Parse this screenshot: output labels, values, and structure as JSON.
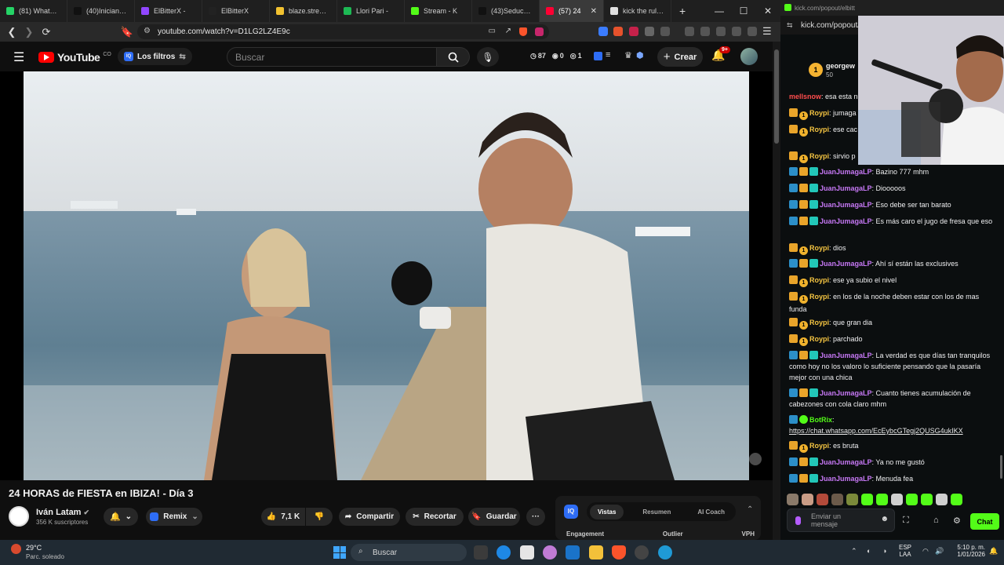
{
  "browser": {
    "tabs": [
      {
        "label": "(81) WhatsApp",
        "color": "#25d366"
      },
      {
        "label": "(40)Iniciando r",
        "color": "#111111"
      },
      {
        "label": "ElBitterX -",
        "color": "#9146ff"
      },
      {
        "label": "ElBitterX",
        "color": "#222222"
      },
      {
        "label": "blaze.stream/s",
        "color": "#f2c230"
      },
      {
        "label": "Llori Pari -",
        "color": "#1db954"
      },
      {
        "label": "Stream - K",
        "color": "#53fc18"
      },
      {
        "label": "(43)SeduceLa",
        "color": "#111111"
      },
      {
        "label": "(57) 24",
        "color": "#ff0033",
        "active": true
      },
      {
        "label": "kick the rules t",
        "color": "#e0e0e0"
      }
    ],
    "new_tab": "+",
    "url": "youtube.com/watch?v=D1LG2LZ4E9c",
    "minimize": "—",
    "maximize": "☐",
    "close": "✕"
  },
  "youtube": {
    "logo": "YouTube",
    "logo_country": "CO",
    "filters_label": "Los filtros",
    "search_placeholder": "Buscar",
    "stats": {
      "views": "87",
      "eye": "0",
      "other": "1"
    },
    "create_label": "Crear",
    "notif_count": "9+",
    "video": {
      "title": "24 HORAS de FIESTA en IBIZA! - Día 3",
      "channel": "Iván Latam",
      "subscribers": "356 K suscriptores",
      "remix_label": "Remix",
      "likes": "7,1 K",
      "share_label": "Compartir",
      "clip_label": "Recortar",
      "save_label": "Guardar",
      "more_label": "···"
    },
    "vidiq": {
      "tabs": [
        "Vistas",
        "Resumen",
        "AI Coach"
      ],
      "active_tab": "Vistas",
      "metrics": [
        "Engagement",
        "Outlier",
        "VPH"
      ]
    }
  },
  "kick": {
    "popout_url": "kick.com/popout/elbitt",
    "popout_url_2": "kick.com/popout/",
    "top_gifter": {
      "name": "georgew",
      "amount": "50"
    },
    "pinned_fragment": {
      "user": "mellsnow",
      "text": ": esa esta n"
    },
    "messages": [
      {
        "user": "Roypi",
        "color": "#f5c542",
        "badges": [
          "crown",
          "sub"
        ],
        "text": ": jumaga"
      },
      {
        "user": "Roypi",
        "color": "#f5c542",
        "badges": [
          "crown",
          "sub"
        ],
        "text": ": ese cac grupo"
      },
      {
        "user": "Roypi",
        "color": "#f5c542",
        "badges": [
          "crown",
          "sub"
        ],
        "text": ": sirvio p"
      },
      {
        "user": "JuanJumagaLP",
        "color": "#c678f5",
        "badges": [
          "arrow",
          "crown",
          "teal"
        ],
        "text": ": Bazino 777 mhm"
      },
      {
        "user": "JuanJumagaLP",
        "color": "#c678f5",
        "badges": [
          "arrow",
          "crown",
          "teal"
        ],
        "text": ": Diooooos"
      },
      {
        "user": "JuanJumagaLP",
        "color": "#c678f5",
        "badges": [
          "arrow",
          "crown",
          "teal"
        ],
        "text": ": Eso debe ser tan barato"
      },
      {
        "user": "JuanJumagaLP",
        "color": "#c678f5",
        "badges": [
          "arrow",
          "crown",
          "teal"
        ],
        "text": ": Es más caro el jugo de fresa que eso"
      },
      {
        "user": "Roypi",
        "color": "#f5c542",
        "badges": [
          "crown",
          "sub"
        ],
        "text": ": dios"
      },
      {
        "user": "JuanJumagaLP",
        "color": "#c678f5",
        "badges": [
          "arrow",
          "crown",
          "teal"
        ],
        "text": ": Ahí sí están las exclusives"
      },
      {
        "user": "Roypi",
        "color": "#f5c542",
        "badges": [
          "crown",
          "sub"
        ],
        "text": ": ese ya subio el nivel"
      },
      {
        "user": "Roypi",
        "color": "#f5c542",
        "badges": [
          "crown",
          "sub"
        ],
        "text": ": en los de la noche deben estar con los de mas funda"
      },
      {
        "user": "Roypi",
        "color": "#f5c542",
        "badges": [
          "crown",
          "sub"
        ],
        "text": ": que gran dia"
      },
      {
        "user": "Roypi",
        "color": "#f5c542",
        "badges": [
          "crown",
          "sub"
        ],
        "text": ": parchado"
      },
      {
        "user": "JuanJumagaLP",
        "color": "#c678f5",
        "badges": [
          "arrow",
          "crown",
          "teal"
        ],
        "text": ": La verdad es que días tan tranquilos como hoy no los valoro lo suficiente pensando que la pasaría mejor con una chica"
      },
      {
        "user": "JuanJumagaLP",
        "color": "#c678f5",
        "badges": [
          "arrow",
          "crown",
          "teal"
        ],
        "text": ": Cuanto tienes acumulación de cabezones con cola claro mhm"
      },
      {
        "user": "BotRix",
        "color": "#53fc18",
        "badges": [
          "arrow",
          "bot"
        ],
        "text": ":",
        "link": "https://chat.whatsapp.com/EcEybcGTegj2QUSG4ukIKX"
      },
      {
        "user": "Roypi",
        "color": "#f5c542",
        "badges": [
          "crown",
          "sub"
        ],
        "text": ": es bruta"
      },
      {
        "user": "JuanJumagaLP",
        "color": "#c678f5",
        "badges": [
          "arrow",
          "crown",
          "teal"
        ],
        "text": ": Ya no me gustó"
      },
      {
        "user": "JuanJumagaLP",
        "color": "#c678f5",
        "badges": [
          "arrow",
          "crown",
          "teal"
        ],
        "text": ": Menuda fea"
      }
    ],
    "input_placeholder": "Enviar un mensaje",
    "chat_button": "Chat",
    "accent": "#53fc18"
  },
  "taskbar": {
    "weather_temp": "29°C",
    "weather_desc": "Parc. soleado",
    "search_placeholder": "Buscar",
    "lang_top": "ESP",
    "lang_bottom": "LAA",
    "time": "5:10 p. m.",
    "date": "1/01/2026"
  }
}
